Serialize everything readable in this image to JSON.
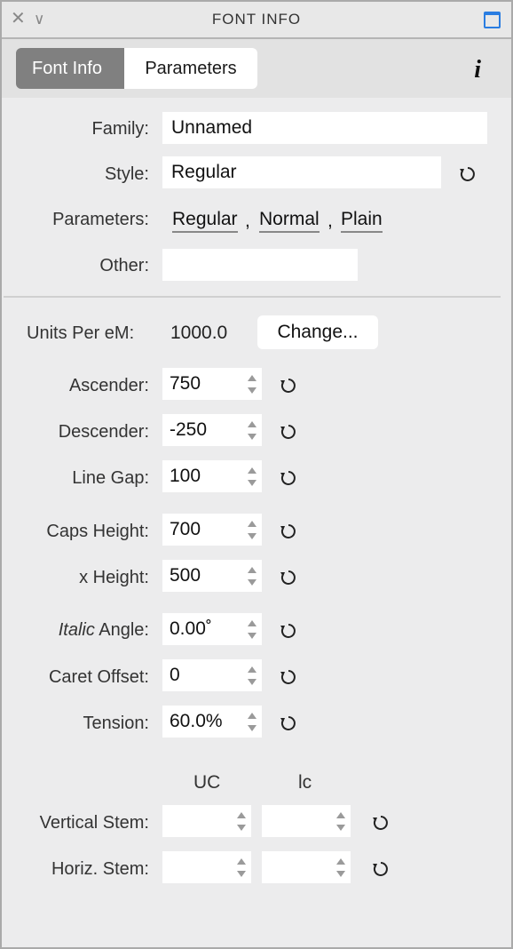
{
  "window": {
    "title": "FONT INFO"
  },
  "tabs": [
    {
      "label": "Font Info",
      "active": true
    },
    {
      "label": "Parameters",
      "active": false
    }
  ],
  "info_button": "i",
  "family": {
    "label": "Family:",
    "value": "Unnamed"
  },
  "style": {
    "label": "Style:",
    "value": "Regular"
  },
  "parameters": {
    "label": "Parameters:",
    "links": [
      "Regular",
      "Normal",
      "Plain"
    ],
    "separator": ","
  },
  "other": {
    "label": "Other:",
    "value": ""
  },
  "units_per_em": {
    "label": "Units Per eM:",
    "value": "1000.0",
    "button": "Change..."
  },
  "metrics": {
    "ascender": {
      "label": "Ascender:",
      "value": "750"
    },
    "descender": {
      "label": "Descender:",
      "value": "-250"
    },
    "line_gap": {
      "label": "Line Gap:",
      "value": "100"
    },
    "caps_height": {
      "label": "Caps Height:",
      "value": "700"
    },
    "x_height": {
      "label": "x Height:",
      "value": "500"
    },
    "italic_angle": {
      "label_italic": "Italic",
      "label_rest": " Angle:",
      "value": "0.00˚"
    },
    "caret_offset": {
      "label": "Caret Offset:",
      "value": "0"
    },
    "tension": {
      "label": "Tension:",
      "value": "60.0%"
    }
  },
  "stems": {
    "columns": [
      "UC",
      "lc"
    ],
    "vertical": {
      "label": "Vertical Stem:",
      "uc": "",
      "lc": ""
    },
    "horizontal": {
      "label": "Horiz. Stem:",
      "uc": "",
      "lc": ""
    }
  },
  "colors": {
    "accent": "#2a7de1",
    "active_tab": "#808080",
    "panel_bg": "#ececed"
  }
}
